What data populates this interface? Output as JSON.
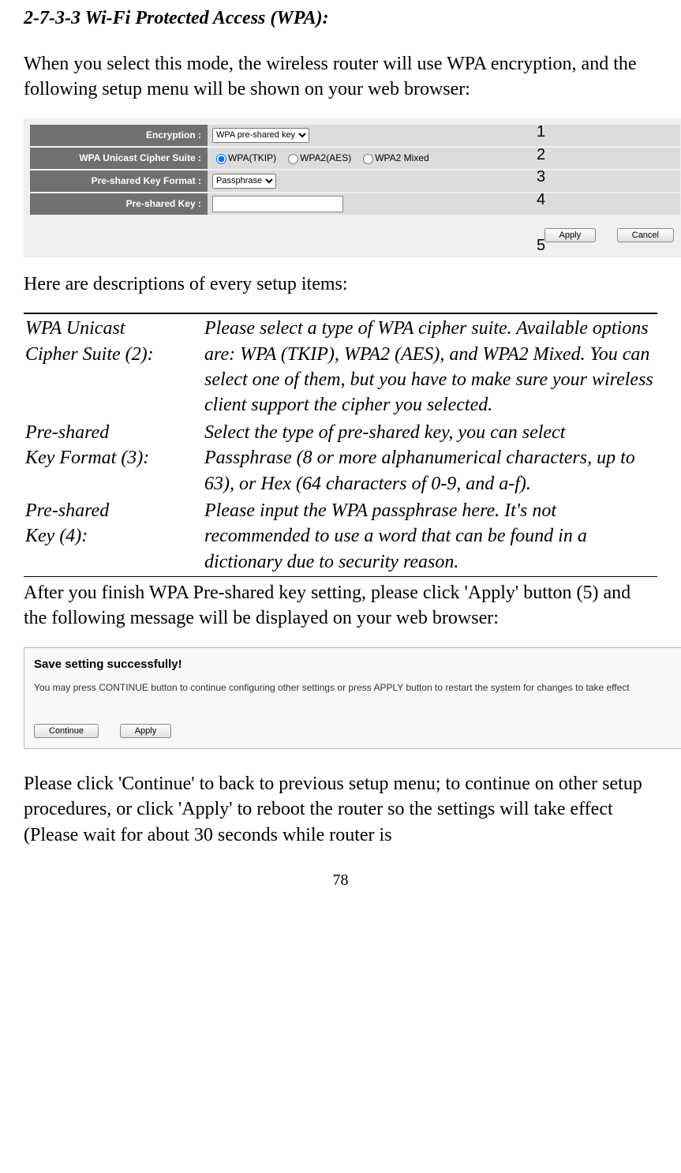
{
  "section_title": "2-7-3-3 Wi-Fi Protected Access (WPA):",
  "intro": "When you select this mode, the wireless router will use WPA encryption, and the following setup menu will be shown on your web browser:",
  "panel": {
    "encryption_label": "Encryption :",
    "encryption_value": "WPA pre-shared key",
    "cipher_label": "WPA Unicast Cipher Suite :",
    "cipher_options": [
      "WPA(TKIP)",
      "WPA2(AES)",
      "WPA2 Mixed"
    ],
    "psk_format_label": "Pre-shared Key Format :",
    "psk_format_value": "Passphrase",
    "psk_label": "Pre-shared Key :",
    "psk_value": "",
    "apply": "Apply",
    "cancel": "Cancel",
    "num1": "1",
    "num2": "2",
    "num3": "3",
    "num4": "4",
    "num5": "5"
  },
  "desc_heading": "Here are descriptions of every setup items:",
  "desc": {
    "r1c1a": "WPA Unicast",
    "r1c1b": "Cipher Suite (2):",
    "r1c2": "Please select a type of WPA cipher suite. Available options are: WPA (TKIP), WPA2 (AES), and WPA2 Mixed. You can select one of them, but you have to make sure your wireless client support the cipher you selected.",
    "r2c1a": "Pre-shared",
    "r2c1b": "Key Format (3):",
    "r2c2": "Select the type of pre-shared key, you can select Passphrase (8 or more alphanumerical characters, up to 63), or Hex (64 characters of 0-9, and a-f).",
    "r3c1a": "Pre-shared",
    "r3c1b": "Key (4):",
    "r3c2": "Please input the WPA passphrase here. It's not recommended to use a word that can be found in a dictionary due to security reason."
  },
  "after_desc": "After you finish WPA Pre-shared key setting, please click 'Apply' button (5) and the following message will be displayed on your web browser:",
  "save_panel": {
    "title": "Save setting successfully!",
    "msg": "You may press CONTINUE button to continue configuring other settings or press APPLY button to restart the system for changes to take effect",
    "continue": "Continue",
    "apply": "Apply"
  },
  "closing": "Please click 'Continue' to back to previous setup menu; to continue on other setup procedures, or click 'Apply' to reboot the router so the settings will take effect (Please wait for about 30 seconds while router is",
  "page_number": "78"
}
